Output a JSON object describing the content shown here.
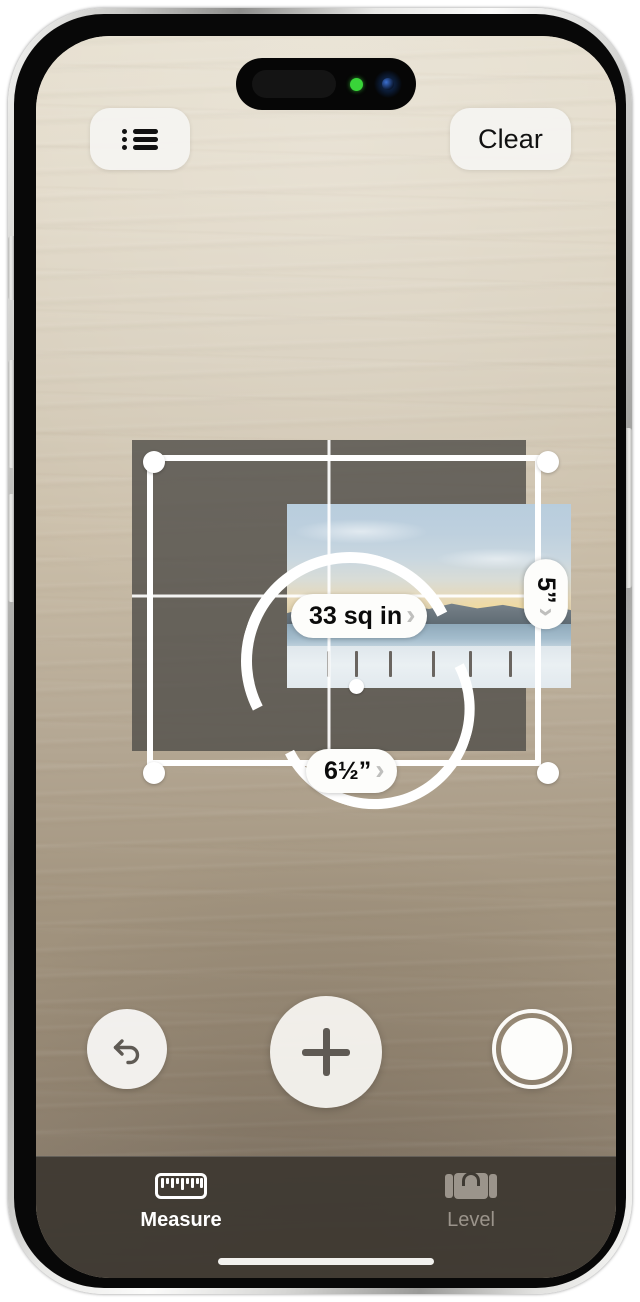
{
  "app": {
    "name": "Measure",
    "status_indicator": "camera-in-use-green-dot"
  },
  "toolbar": {
    "list_button_icon": "bulleted-list-icon",
    "list_button_label": "",
    "clear_label": "Clear"
  },
  "measurement": {
    "area_label": "33 sq in",
    "width_label": "6½”",
    "height_label": "5”",
    "chevron_glyph": "›",
    "center_point": "measure-center-dot",
    "surface_color": "#524f4b",
    "line_color": "#ffffff"
  },
  "controls": {
    "undo_icon": "undo-arrow-icon",
    "undo_glyph": "↩",
    "add_icon": "plus-icon",
    "shutter_icon": "camera-shutter-icon"
  },
  "tabs": [
    {
      "label": "Measure",
      "icon": "ruler-icon",
      "active": true
    },
    {
      "label": "Level",
      "icon": "bubble-level-icon",
      "active": false
    }
  ],
  "colors": {
    "pill_background": "#fdfdfb",
    "pill_text": "#0b0b0b",
    "chevron": "#bfbfbd",
    "tab_active": "#ffffff",
    "tab_inactive": "#9b948b",
    "tab_bar_background": "#3e3932",
    "button_background": "#f4f3f0",
    "privacy_dot": "#39d439"
  }
}
